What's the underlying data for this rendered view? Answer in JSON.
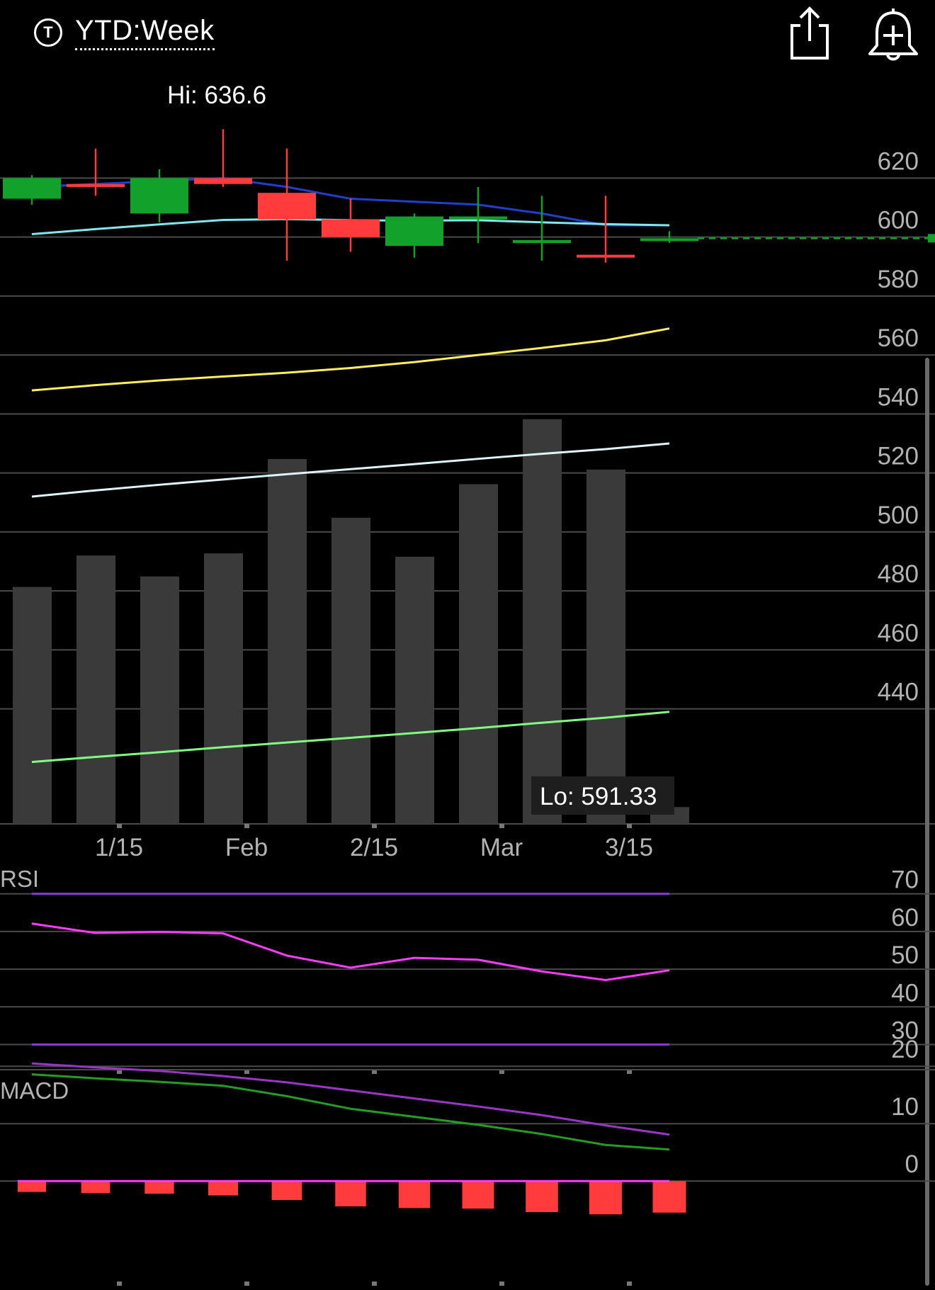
{
  "header": {
    "ticker_icon": "T",
    "range_title": "YTD:Week",
    "share_icon": "share-icon",
    "alert_icon": "bell-plus-icon"
  },
  "chart_data": {
    "type": "candlestick",
    "x_ticks": [
      "1/15",
      "Feb",
      "2/15",
      "Mar",
      "3/15"
    ],
    "price": {
      "y_ticks": [
        620,
        600,
        580,
        560,
        540,
        520,
        500,
        480,
        460,
        440
      ],
      "ylim": [
        401,
        641
      ],
      "hi_label": "Hi: 636.6",
      "lo_label": "Lo: 591.33",
      "last_price": 599.6,
      "candles": [
        {
          "open": 613,
          "close": 620,
          "high": 621,
          "low": 611,
          "color": "#12a12a"
        },
        {
          "open": 618,
          "close": 617,
          "high": 630,
          "low": 614,
          "color": "#ff3b3b"
        },
        {
          "open": 608,
          "close": 620,
          "high": 623,
          "low": 605,
          "color": "#12a12a"
        },
        {
          "open": 620,
          "close": 618,
          "high": 636.6,
          "low": 617,
          "color": "#ff3b3b"
        },
        {
          "open": 615,
          "close": 606,
          "high": 630,
          "low": 592,
          "color": "#ff3b3b"
        },
        {
          "open": 606,
          "close": 600,
          "high": 613,
          "low": 595,
          "color": "#ff3b3b"
        },
        {
          "open": 597,
          "close": 607,
          "high": 608,
          "low": 593,
          "color": "#12a12a"
        },
        {
          "open": 606,
          "close": 607,
          "high": 617,
          "low": 598,
          "color": "#12a12a"
        },
        {
          "open": 598,
          "close": 599,
          "high": 614,
          "low": 592,
          "color": "#12a12a"
        },
        {
          "open": 594,
          "close": 594,
          "high": 614,
          "low": 591.33,
          "color": "#ff3b3b"
        },
        {
          "open": 599.6,
          "close": 599.6,
          "high": 602,
          "low": 598,
          "color": "#12a12a"
        }
      ],
      "ma_lines": [
        {
          "color": "#1f3fcf",
          "values": [
            617,
            618,
            619,
            620,
            617,
            613,
            612,
            611,
            608,
            604,
            604
          ]
        },
        {
          "color": "#7fe8ee",
          "values": [
            601,
            602.7,
            604.3,
            605.8,
            606.1,
            605.7,
            605.6,
            605.7,
            605,
            604.4,
            604
          ]
        },
        {
          "color": "#ffef5c",
          "values": [
            548,
            549.8,
            551.4,
            552.7,
            554,
            555.6,
            557.6,
            560,
            562.4,
            565,
            569
          ]
        },
        {
          "color": "#ddf4f8",
          "values": [
            512,
            514.1,
            516,
            517.8,
            519.6,
            521.3,
            523,
            524.8,
            526.5,
            528.1,
            530
          ]
        },
        {
          "color": "#80ff80",
          "values": [
            422,
            423.7,
            425.3,
            427,
            428.6,
            430.2,
            431.8,
            433.5,
            435.3,
            437,
            439
          ]
        }
      ],
      "volume": [
        0.565,
        0.64,
        0.59,
        0.645,
        0.87,
        0.73,
        0.637,
        0.81,
        0.965,
        0.845,
        0.04
      ]
    },
    "rsi": {
      "title": "RSI",
      "y_ticks": [
        70,
        60,
        50,
        40,
        30
      ],
      "ylim": [
        26.9,
        73.3
      ],
      "overbought": 70,
      "oversold": 30,
      "line_color": "#ff3bff",
      "band_color": "#8a3ad8",
      "values": [
        62.1,
        59.6,
        59.9,
        59.5,
        53.6,
        50.4,
        53,
        52.5,
        49.4,
        47.1,
        49.7
      ]
    },
    "macd": {
      "title": "MACD",
      "y_ticks": [
        20,
        10,
        0
      ],
      "ylim": [
        -9.6,
        24
      ],
      "macd_line": {
        "color": "#9a36c6",
        "values": [
          20.5,
          19.8,
          19.2,
          18.3,
          17.2,
          15.8,
          14.4,
          13,
          11.5,
          9.7,
          8.1
        ]
      },
      "signal_line": {
        "color": "#239d23",
        "values": [
          18.6,
          17.9,
          17.3,
          16.6,
          14.8,
          12.6,
          11.2,
          9.8,
          8.2,
          6.3,
          5.5
        ]
      },
      "zero_line_color": "#ff3bff",
      "histogram": [
        -1.9,
        -2.1,
        -2.2,
        -2.5,
        -3.3,
        -4.4,
        -4.7,
        -4.8,
        -5.4,
        -5.8,
        -5.5
      ]
    }
  }
}
